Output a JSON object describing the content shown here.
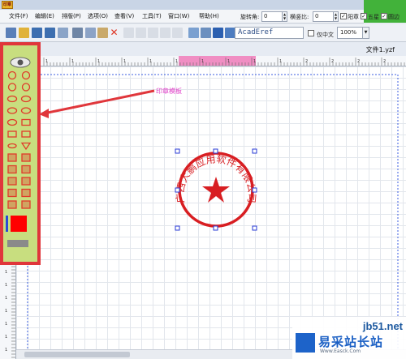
{
  "app": {
    "icon_label": "印章"
  },
  "menu": [
    "文件(F)",
    "编辑(E)",
    "排版(P)",
    "选项(O)",
    "查看(V)",
    "工具(T)",
    "窗口(W)",
    "帮助(H)"
  ],
  "properties": {
    "rotate_label": "旋转角:",
    "rotate_value": "0",
    "ratio_label": "横竖比:",
    "ratio_value": "0",
    "yang_label": "阳章",
    "yang_checked": "✓",
    "star_label": "五星",
    "star_checked": "✓",
    "border_label": "圆边",
    "border_checked": "✓"
  },
  "toolbar": {
    "font_value": "AcadEref",
    "vertical_label": "仅中文",
    "zoom_value": "100%"
  },
  "document": {
    "title": "文件1.yzf"
  },
  "annotation": "印章模板",
  "seal": {
    "text": "广西大鹏应用软件有限公司",
    "color": "#d81e22"
  },
  "ruler_top": [
    "1",
    "1",
    "1",
    "1",
    "1",
    "1",
    "1",
    "1",
    "1",
    "1",
    "2",
    "2",
    "2",
    "2"
  ],
  "ruler_left": [
    "1",
    "1",
    "1",
    "1",
    "1",
    "1",
    "1"
  ],
  "watermark": {
    "site": "jb51.net",
    "name": "易采站长站",
    "url": "Www.Easck.Com"
  },
  "colors": {
    "accent_red": "#e0363b",
    "palette_bg": "#c8de7f",
    "seal_red": "#d81e22",
    "annotation": "#e040c8"
  }
}
